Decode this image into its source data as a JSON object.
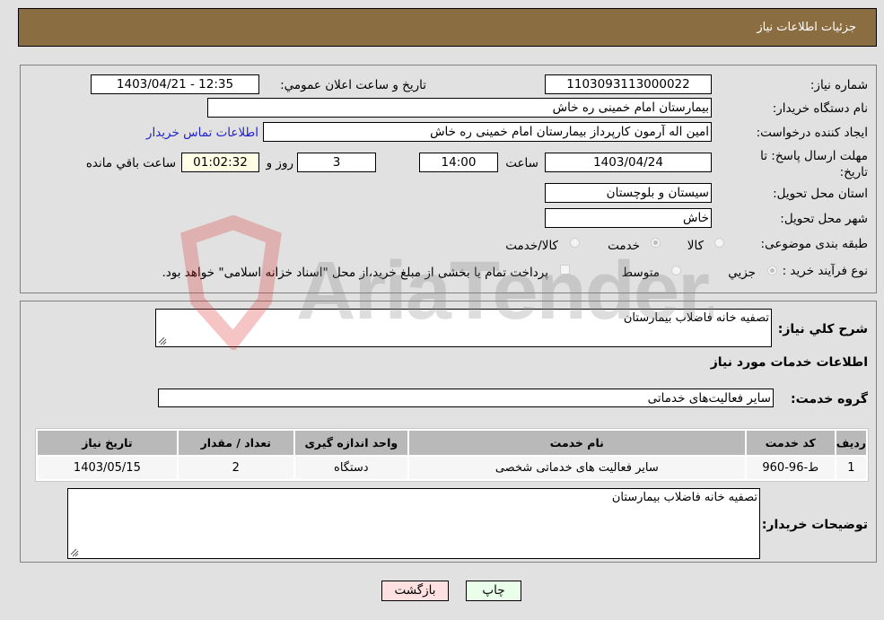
{
  "header": {
    "title": "جزئیات اطلاعات نیاز"
  },
  "form": {
    "need_number": {
      "label": "شماره نیاز:",
      "value": "1103093113000022"
    },
    "announce_datetime": {
      "label": "تاریخ و ساعت اعلان عمومي:",
      "value": "1403/04/21 - 12:35"
    },
    "buyer_org": {
      "label": "نام دستگاه خریدار:",
      "value": "بیمارستان امام خمینی  ره  خاش"
    },
    "requester": {
      "label": "ایجاد کننده درخواست:",
      "value": "امین اله آرمون کارپرداز بیمارستان امام خمینی  ره  خاش",
      "contact_link": "اطلاعات تماس خریدار"
    },
    "deadline": {
      "label": "مهلت ارسال پاسخ: تا تاریخ:",
      "date": "1403/04/24",
      "time_label": "ساعت",
      "time": "14:00",
      "days": "3",
      "days_label": "روز و",
      "remaining": "01:02:32",
      "remaining_label": "ساعت باقي مانده"
    },
    "province": {
      "label": "استان محل تحویل:",
      "value": "سیستان و بلوچستان"
    },
    "city": {
      "label": "شهر محل تحویل:",
      "value": "خاش"
    },
    "category": {
      "label": "طبقه بندی موضوعی:",
      "options": [
        {
          "label": "کالا",
          "selected": false
        },
        {
          "label": "خدمت",
          "selected": true
        },
        {
          "label": "کالا/خدمت",
          "selected": false
        }
      ]
    },
    "purchase_type": {
      "label": "نوع فرآیند خرید :",
      "options": [
        {
          "label": "جزيي",
          "selected": true
        },
        {
          "label": "متوسط",
          "selected": false
        }
      ],
      "treasury_note": "پرداخت تمام یا بخشی از مبلغ خرید،از محل \"اسناد خزانه اسلامی\" خواهد بود."
    }
  },
  "details": {
    "general_desc_label": "شرح کلي نياز:",
    "general_desc": "تصفیه خانه فاضلاب  بیمارستان",
    "services_title": "اطلاعات خدمات مورد نياز",
    "service_group_label": "گروه خدمت:",
    "service_group": "سایر فعالیت‌های خدماتی",
    "table": {
      "headers": [
        "رديف",
        "کد خدمت",
        "نام خدمت",
        "واحد اندازه گيری",
        "تعداد / مقدار",
        "تاريخ نياز"
      ],
      "rows": [
        [
          "1",
          "ط-96-960",
          "سایر فعالیت های خدماتی شخصی",
          "دستگاه",
          "2",
          "1403/05/15"
        ]
      ]
    },
    "buyer_notes_label": "توضيحات خريدار:",
    "buyer_notes": "تصفیه خانه فاضلاب  بیمارستان"
  },
  "buttons": {
    "print": "چاپ",
    "back": "بازگشت"
  },
  "watermark": {
    "text": "AriaTender.neT"
  },
  "colors": {
    "header_bg": "#8b6d42",
    "print_bg": "#eaffea",
    "back_bg": "#ffe0e0",
    "timer_bg": "#ffffe6",
    "link": "#2222cc"
  }
}
